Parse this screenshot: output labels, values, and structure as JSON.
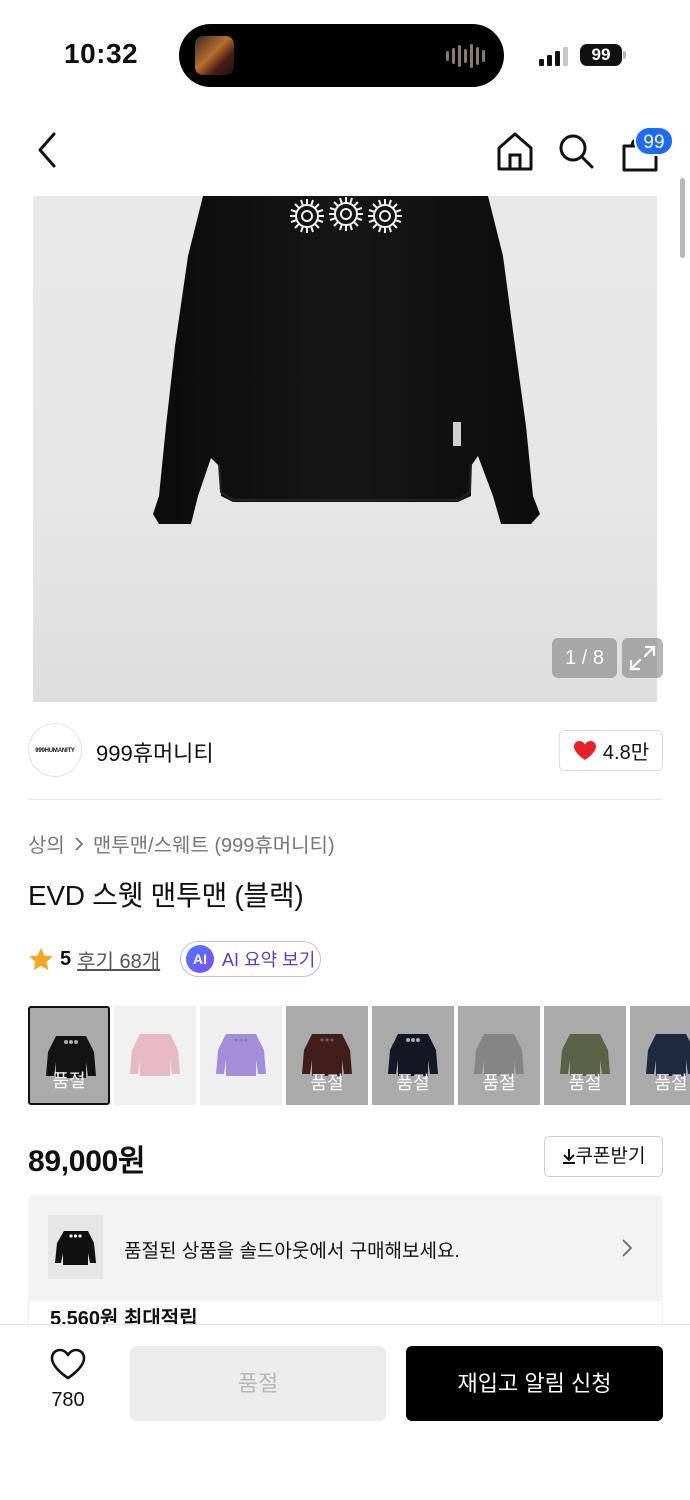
{
  "status_bar": {
    "time": "10:32",
    "battery": "99"
  },
  "nav": {
    "cart_count": "99"
  },
  "gallery": {
    "counter": "1 / 8"
  },
  "brand": {
    "logo_text": "999HUMANITY",
    "name": "999휴머니티",
    "like_count": "4.8만"
  },
  "breadcrumb": {
    "category": "상의",
    "subcategory": "맨투맨/스웨트 (999휴머니티)"
  },
  "product": {
    "title": "EVD 스웻 맨투맨 (블랙)",
    "rating": "5",
    "reviews": "후기 68개",
    "ai_summary_label": "AI 요약 보기",
    "ai_badge": "AI",
    "price": "89,000원",
    "coupon_label": "쿠폰받기"
  },
  "colors": {
    "sold_label": "품절",
    "swatches": [
      {
        "color": "#1b1b1b",
        "bg": "#ececec",
        "soldout": true
      },
      {
        "color": "#e6b9c3",
        "bg": "#f0f0f0",
        "soldout": false
      },
      {
        "color": "#a48ed8",
        "bg": "#efefef",
        "soldout": false
      },
      {
        "color": "#5b2a26",
        "bg": "#e9e9e9",
        "soldout": true
      },
      {
        "color": "#1c2233",
        "bg": "#ececec",
        "soldout": true
      },
      {
        "color": "#b9b9b9",
        "bg": "#ececec",
        "soldout": true
      },
      {
        "color": "#7f8a61",
        "bg": "#ececec",
        "soldout": true
      },
      {
        "color": "#2a3a5c",
        "bg": "#ececec",
        "soldout": true
      }
    ]
  },
  "soldout_banner": {
    "text": "품절된 상품을 솔드아웃에서 구매해보세요."
  },
  "points": {
    "text": "5,560원 최대적립"
  },
  "bottom_bar": {
    "like_count": "780",
    "sold_button": "품절",
    "restock_button": "재입고 알림 신청"
  },
  "accent_colors": {
    "heart": "#e8202a",
    "star": "#f5a623",
    "badge": "#1e6bf0",
    "ai": "#5a3fc0"
  }
}
